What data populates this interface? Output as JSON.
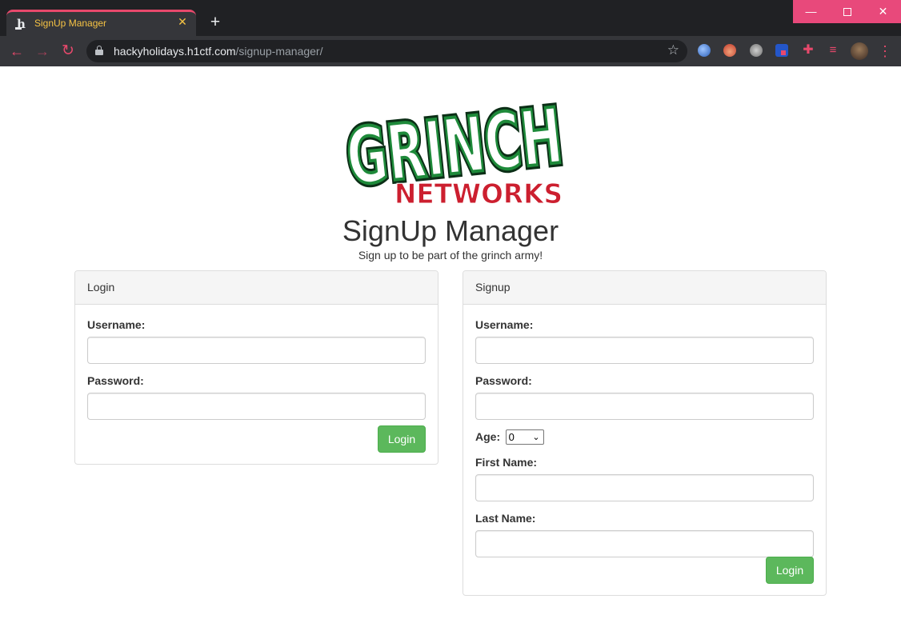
{
  "browser": {
    "tab_title": "SignUp Manager",
    "tab_favicon": "h",
    "url_domain": "hackyholidays.h1ctf.com",
    "url_path": "/signup-manager/"
  },
  "page": {
    "logo_text_top": "GRINCH",
    "logo_text_bottom": "NETWORKS",
    "title": "SignUp Manager",
    "subtitle": "Sign up to be part of the grinch army!"
  },
  "login": {
    "heading": "Login",
    "username_label": "Username:",
    "password_label": "Password:",
    "username_value": "",
    "password_value": "",
    "button_label": "Login"
  },
  "signup": {
    "heading": "Signup",
    "username_label": "Username:",
    "password_label": "Password:",
    "age_label": "Age:",
    "age_value": "0",
    "firstname_label": "First Name:",
    "lastname_label": "Last Name:",
    "button_label": "Login"
  },
  "colors": {
    "accent": "#e8496c",
    "tab_title": "#f6c344",
    "button": "#5cb85c",
    "logo_green": "#1e8a3a",
    "logo_red": "#cc1f2f"
  },
  "icons": {
    "back": "arrow-left-icon",
    "forward": "arrow-right-icon",
    "reload": "reload-icon",
    "lock": "lock-icon",
    "bookmark": "star-icon",
    "menu": "more-vertical-icon"
  }
}
